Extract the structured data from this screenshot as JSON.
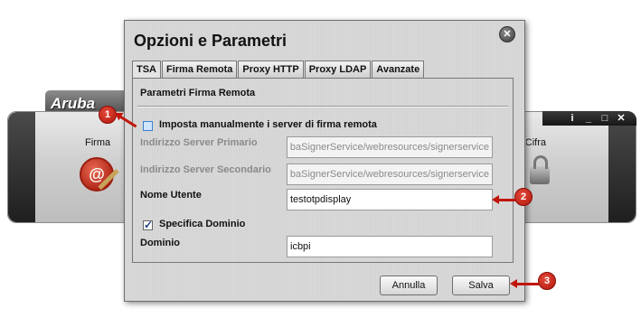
{
  "background_app": {
    "logo": "Aruba",
    "left_label": "Firma",
    "right_label": "Cifra",
    "controls": [
      "info-icon",
      "minimize-icon",
      "maximize-icon",
      "close-icon"
    ]
  },
  "dialog": {
    "title": "Opzioni e Parametri",
    "close_icon": "close-icon",
    "tabs": [
      {
        "label": "TSA",
        "active": true
      },
      {
        "label": "Firma Remota",
        "active": false
      },
      {
        "label": "Proxy HTTP",
        "active": false
      },
      {
        "label": "Proxy LDAP",
        "active": false
      },
      {
        "label": "Avanzate",
        "active": false
      }
    ],
    "section_title": "Parametri Firma Remota",
    "manual_servers": {
      "label": "Imposta manualmente i server di firma remota",
      "checked": false
    },
    "primary_server": {
      "label": "Indirizzo Server Primario",
      "value": "arubaSignerService/webresources/signerservice",
      "enabled": false
    },
    "secondary_server": {
      "label": "Indirizzo Server Secondario",
      "value": "arubaSignerService/webresources/signerservice",
      "enabled": false
    },
    "username": {
      "label": "Nome Utente",
      "value": "testotpdisplay"
    },
    "specify_domain": {
      "label": "Specifica Dominio",
      "checked": true
    },
    "domain": {
      "label": "Dominio",
      "value": "icbpi"
    },
    "cancel_label": "Annulla",
    "save_label": "Salva"
  },
  "callouts": [
    "1",
    "2",
    "3"
  ]
}
